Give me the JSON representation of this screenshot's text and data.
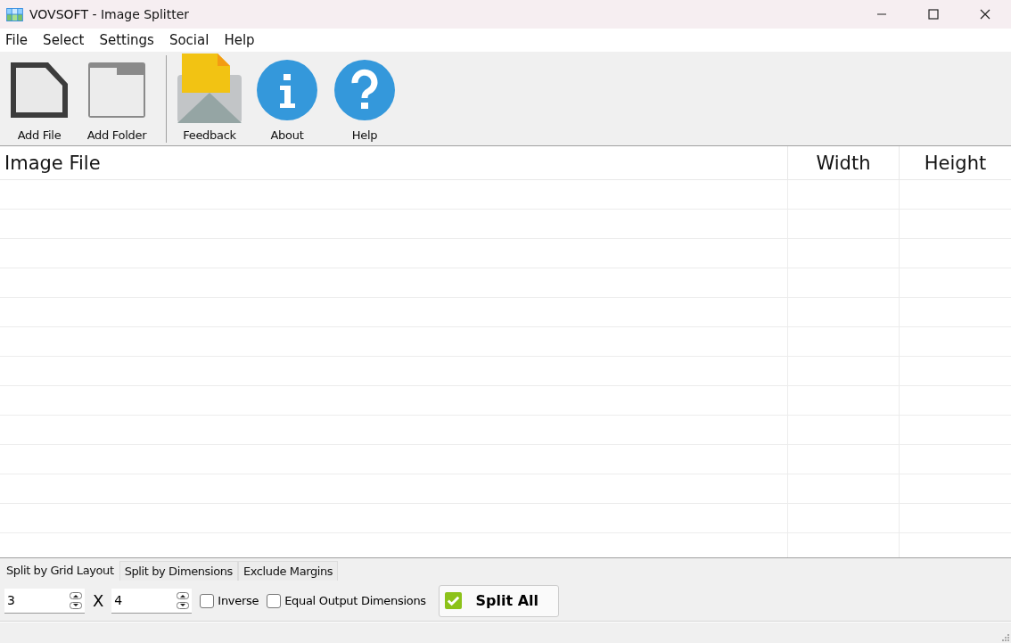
{
  "window": {
    "title": "VOVSOFT - Image Splitter"
  },
  "menu": [
    "File",
    "Select",
    "Settings",
    "Social",
    "Help"
  ],
  "toolbar": [
    {
      "label": "Add File",
      "kind": "file"
    },
    {
      "label": "Add Folder",
      "kind": "folder"
    },
    {
      "label": "Feedback",
      "kind": "feedback"
    },
    {
      "label": "About",
      "kind": "about"
    },
    {
      "label": "Help",
      "kind": "help"
    }
  ],
  "table": {
    "columns": [
      "Image File",
      "Width",
      "Height"
    ]
  },
  "tabs": [
    {
      "label": "Split by Grid Layout",
      "selected": true
    },
    {
      "label": "Split by Dimensions",
      "selected": false
    },
    {
      "label": "Exclude Margins",
      "selected": false
    }
  ],
  "grid": {
    "columns": "3",
    "separator": "X",
    "rows": "4"
  },
  "options": [
    {
      "label": "Inverse",
      "checked": false
    },
    {
      "label": "Equal Output Dimensions",
      "checked": false
    }
  ],
  "split_button": "Split All"
}
